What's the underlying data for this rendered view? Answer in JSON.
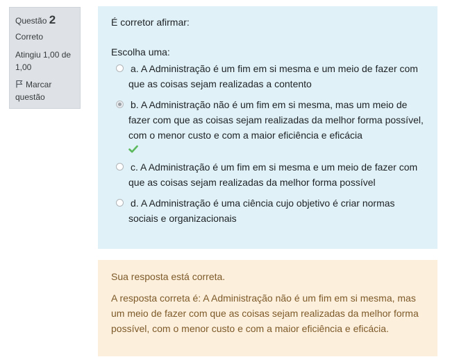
{
  "info": {
    "question_label": "Questão",
    "question_number": "2",
    "state": "Correto",
    "grade": "Atingiu 1,00 de 1,00",
    "flag_label": "Marcar questão"
  },
  "formulation": {
    "question_text": "É corretor afirmar:",
    "prompt": "Escolha uma:",
    "options": [
      {
        "letter": "a.",
        "text": "A Administração é um fim em si mesma e um meio de fazer com que as coisas sejam realizadas a contento",
        "checked": false
      },
      {
        "letter": "b.",
        "text": "A Administração não é um fim em si mesma, mas um meio de fazer com que as coisas sejam realizadas da melhor forma possível, com o menor custo e com a maior eficiência e eficácia",
        "checked": true
      },
      {
        "letter": "c.",
        "text": "A Administração é um fim em si mesma e um meio de fazer com que as coisas sejam realizadas da melhor forma possível",
        "checked": false
      },
      {
        "letter": "d.",
        "text": "A Administração é uma ciência cujo objetivo é criar normas sociais e organizacionais",
        "checked": false
      }
    ]
  },
  "outcome": {
    "status": "Sua resposta está correta.",
    "right_answer": "A resposta correta é: A Administração não é um fim em si mesma, mas um meio de fazer com que as coisas sejam realizadas da melhor forma possível, com o menor custo e com a maior eficiência e eficácia."
  },
  "colors": {
    "info_bg": "#dee2e6",
    "formulation_bg": "#e0f2f7",
    "outcome_bg": "#fcefdc",
    "correct_check": "#5cb85c"
  },
  "icons": {
    "flag": "flag-icon",
    "correct": "check-icon"
  }
}
